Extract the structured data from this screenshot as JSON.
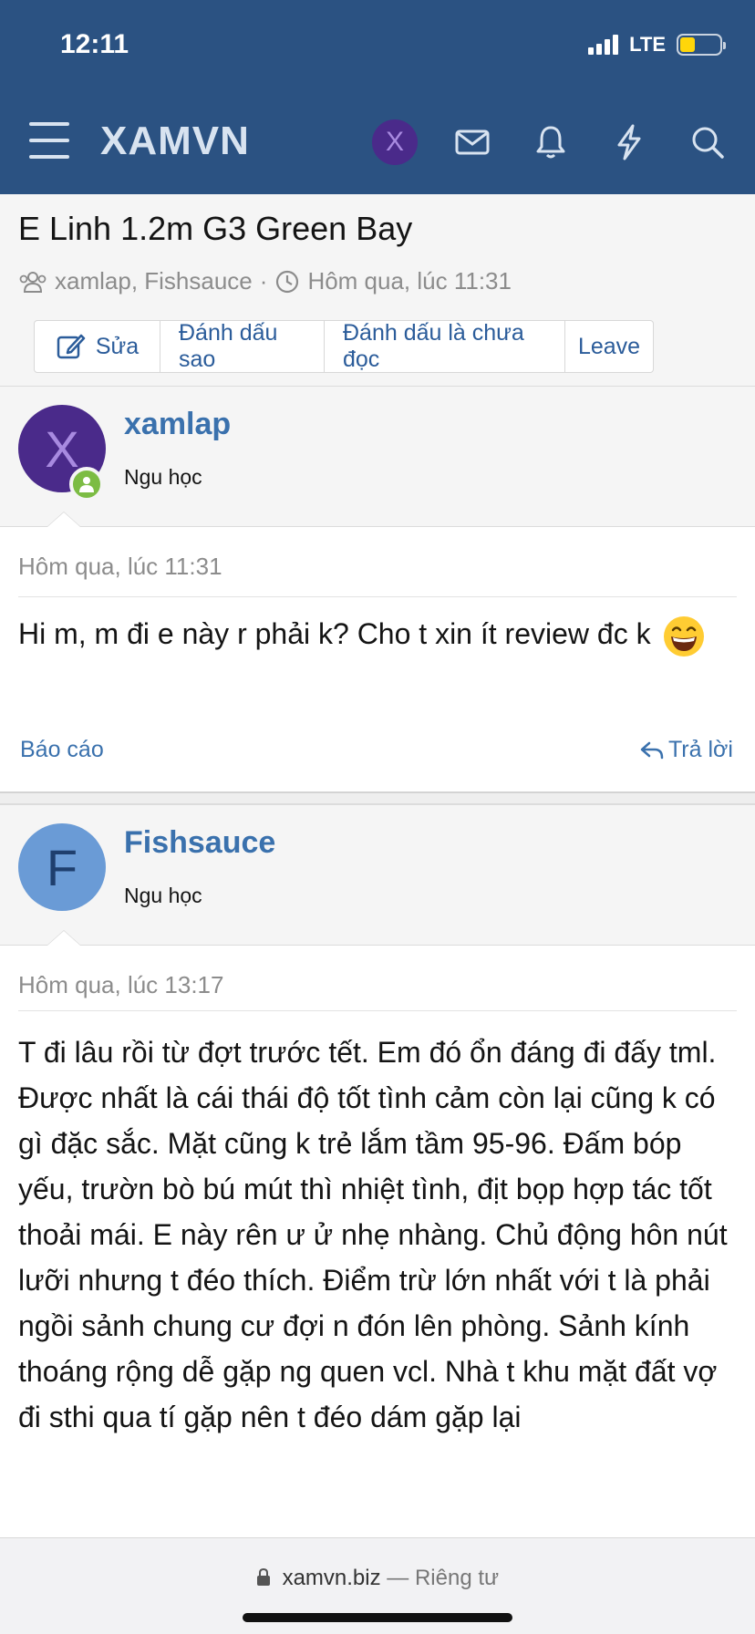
{
  "status_bar": {
    "time": "12:11",
    "network": "LTE"
  },
  "header": {
    "logo": "XAMVN",
    "avatar_letter": "X"
  },
  "thread": {
    "title": "E Linh 1.2m G3 Green Bay",
    "participants": "xamlap, Fishsauce",
    "separator": "·",
    "date": "Hôm qua, lúc 11:31",
    "buttons": {
      "edit": "Sửa",
      "star": "Đánh dấu sao",
      "unread": "Đánh dấu là chưa đọc",
      "leave": "Leave"
    }
  },
  "posts": [
    {
      "username": "xamlap",
      "user_title": "Ngu học",
      "avatar_letter": "X",
      "avatar_bg": "#4a2a8a",
      "avatar_fg": "#a88ae0",
      "date": "Hôm qua, lúc 11:31",
      "text": "Hi m, m đi e này r phải k? Cho t xin ít review đc k",
      "report": "Báo cáo",
      "reply": "Trả lời"
    },
    {
      "username": "Fishsauce",
      "user_title": "Ngu học",
      "avatar_letter": "F",
      "avatar_bg": "#6a9bd6",
      "avatar_fg": "#1f3f6e",
      "date": "Hôm qua, lúc 13:17",
      "text": "T đi lâu rồi từ đợt trước tết. Em đó ổn đáng đi đấy tml. Được nhất là cái thái độ tốt tình cảm còn lại cũng k có gì đặc sắc. Mặt cũng k trẻ lắm tầm 95-96. Đấm bóp yếu, trườn bò bú mút thì nhiệt tình, địt bọp hợp tác tốt thoải mái. E này rên ư ử nhẹ nhàng. Chủ động hôn nút lưỡi nhưng t đéo thích. Điểm trừ lớn nhất với t là phải ngồi sảnh chung cư đợi n đón lên phòng. Sảnh kính thoáng rộng dễ gặp ng quen vcl. Nhà t khu mặt đất vợ đi sthi qua tí gặp nên t đéo dám gặp lại"
    }
  ],
  "browser": {
    "domain": "xamvn.biz",
    "dash": "—",
    "mode": "Riêng tư"
  },
  "colors": {
    "header_bg": "#2b5282",
    "link": "#3a71ad",
    "online": "#7cbc44"
  }
}
